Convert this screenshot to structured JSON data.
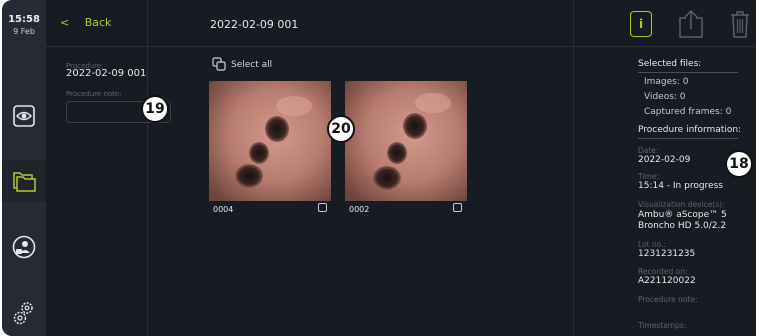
{
  "clock": {
    "time": "15:58",
    "date": "9 Feb"
  },
  "header": {
    "back_label": "Back",
    "chevron": "<",
    "title": "2022-02-09 001",
    "info_label": "i"
  },
  "left_panel": {
    "procedure_label": "Procedure:",
    "procedure_value": "2022-02-09 001",
    "note_label": "Procedure note:",
    "note_value": ""
  },
  "gallery": {
    "select_all": "Select all",
    "items": [
      {
        "label": "0004",
        "checked": false
      },
      {
        "label": "0002",
        "checked": false
      }
    ]
  },
  "callouts": {
    "c18": "18",
    "c19": "19",
    "c20": "20"
  },
  "right_panel": {
    "selected_title": "Selected files:",
    "images": "Images: 0",
    "videos": "Videos: 0",
    "frames": "Captured frames: 0",
    "info_title": "Procedure information:",
    "date_label": "Date:",
    "date_value": "2022-02-09",
    "time_label": "Time:",
    "time_value": "15:14 - In progress",
    "device_label": "Visualization device(s):",
    "device_value_1": "Ambu® aScope™ 5",
    "device_value_2": "Broncho HD 5.0/2.2",
    "lot_label": "Lot no.:",
    "lot_value": "1231231235",
    "recorded_label": "Recorded on:",
    "recorded_value": "A221120022",
    "note_label": "Procedure note:",
    "timestamps_label": "Timestamps:"
  },
  "colors": {
    "accent": "#b9c62a",
    "background": "#171b22",
    "rail": "#262b33"
  },
  "icons": [
    "eye-icon",
    "folder-icon",
    "user-lock-icon",
    "settings-icon",
    "info-icon",
    "upload-icon",
    "trash-icon",
    "copy-icon",
    "checkbox-icon"
  ]
}
